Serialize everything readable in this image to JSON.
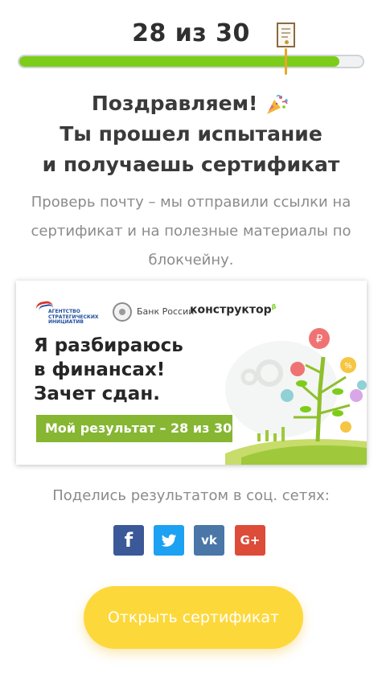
{
  "score": {
    "text": "28 из 30",
    "correct": 28,
    "total": 30
  },
  "progress": {
    "fraction": 0.933,
    "fill_color": "#7ccd1a",
    "marker_color": "#e9a829"
  },
  "headline": {
    "line1": "Поздравляем!",
    "line2": "Ты прошел испытание",
    "line3": "и получаешь сертификат",
    "emoji_icon": "party-popper-icon"
  },
  "subtext": "Проверь почту – мы отправили ссылки на сертификат и на полезные материалы по блокчейну.",
  "banner": {
    "logos": {
      "asi": "АГЕНТСТВО СТРАТЕГИЧЕСКИХ ИНИЦИАТИВ",
      "bank": "Банк России",
      "konstruktor": "конструктор",
      "konstruktor_mark": "β"
    },
    "title_line1": "Я разбираюсь",
    "title_line2": "в финансах!",
    "title_line3": "Зачет сдан.",
    "result": "Мой результат – 28 из 30",
    "art": {
      "ruble": "₽",
      "percent": "%"
    }
  },
  "share": {
    "label": "Поделись результатом в соц. сетях:",
    "buttons": [
      {
        "name": "facebook",
        "glyph": "f",
        "color": "#3b5998"
      },
      {
        "name": "twitter",
        "glyph": "twitter-bird-icon",
        "color": "#1da1f2"
      },
      {
        "name": "vk",
        "glyph": "vk",
        "color": "#4a76a8"
      },
      {
        "name": "google-plus",
        "glyph": "G+",
        "color": "#dd4b39"
      }
    ]
  },
  "cta": {
    "label": "Открыть сертификат",
    "color": "#fdd83b"
  }
}
